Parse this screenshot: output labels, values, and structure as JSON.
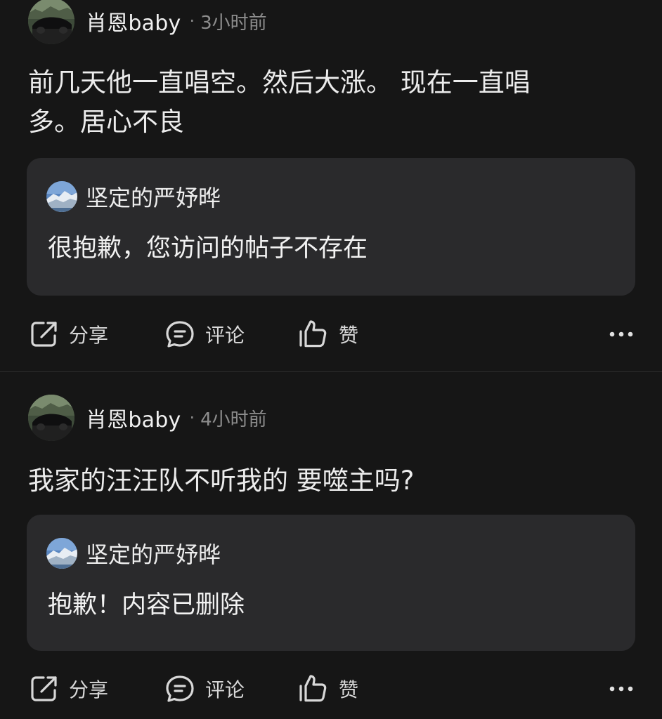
{
  "posts": [
    {
      "author": "肖恩baby",
      "separator": "·",
      "time_ago": "3小时前",
      "text_line1": "前几天他一直唱空。然后大涨。 现在一直唱",
      "text_line2": "多。居心不良",
      "quote": {
        "author": "坚定的严妤晔",
        "text": "很抱歉，您访问的帖子不存在"
      },
      "actions": {
        "share": "分享",
        "comment": "评论",
        "like": "赞"
      }
    },
    {
      "author": "肖恩baby",
      "separator": "·",
      "time_ago": "4小时前",
      "text": "我家的汪汪队不听我的 要噬主吗?",
      "quote": {
        "author": "坚定的严妤晔",
        "text": "抱歉！内容已删除"
      },
      "actions": {
        "share": "分享",
        "comment": "评论",
        "like": "赞"
      }
    }
  ],
  "icons": {
    "share": "share-icon",
    "comment": "comment-icon",
    "like": "thumbs-up-icon",
    "more": "more-horizontal-icon"
  },
  "colors": {
    "background": "#161616",
    "card": "#2a2a2c",
    "text_primary": "#ececec",
    "text_secondary": "#8d8d8d"
  }
}
